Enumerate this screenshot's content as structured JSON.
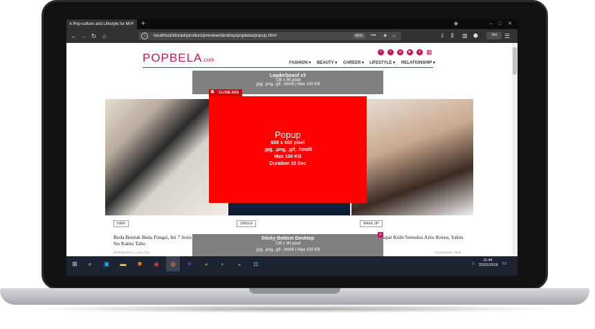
{
  "browser": {
    "tab_title": "A Pop-culture and Lifestyle for Mi",
    "url": "localhost/idn/adsproduct/preview/desktop/popbela/popup.html",
    "zoom": "80%",
    "badge": "764"
  },
  "site": {
    "logo_main": "POPBELA",
    "logo_suffix": ".com",
    "nav": [
      "FASHION ▾",
      "BEAUTY ▾",
      "CAREER ▾",
      "LIFESTYLE ▾",
      "RELATIONSHIP ▾"
    ]
  },
  "ads": {
    "leaderboard": {
      "title": "Leaderboard v3",
      "size": "728 x 90 pixel",
      "formats": ".jpg, .png, .gif, .html5 | Max 100 KB"
    },
    "close_ads": "CLOSE ADS",
    "popup": {
      "title": "Popup",
      "size": "600 x 400 pixel",
      "formats": ".jpg, .png, .gif, .html5",
      "max": "Max 100 KB",
      "duration": "Duration 15 Sec"
    },
    "sticky": {
      "title": "Sticky Bottom Desktop",
      "size": "728 x 90 pixel",
      "formats": ".jpg, .png, .gif, .html5 | Max 100 KB"
    }
  },
  "cards": [
    {
      "tag": "HAIR",
      "title": "Beda Bentuk Beda Fungsi, Ini 7 Jenis Sis Kamu Tahu",
      "date": "DIPERBARUI 1 JAN 2019"
    },
    {
      "tag": "SINGLE",
      "title": "",
      "date": ""
    },
    {
      "tag": "MAKE UP",
      "title": "apat Kulit Semulus Artis Korea, Yakin",
      "date": "24 Desember 2018"
    }
  ],
  "taskbar": {
    "time": "11:44",
    "date": "22/01/2019"
  }
}
